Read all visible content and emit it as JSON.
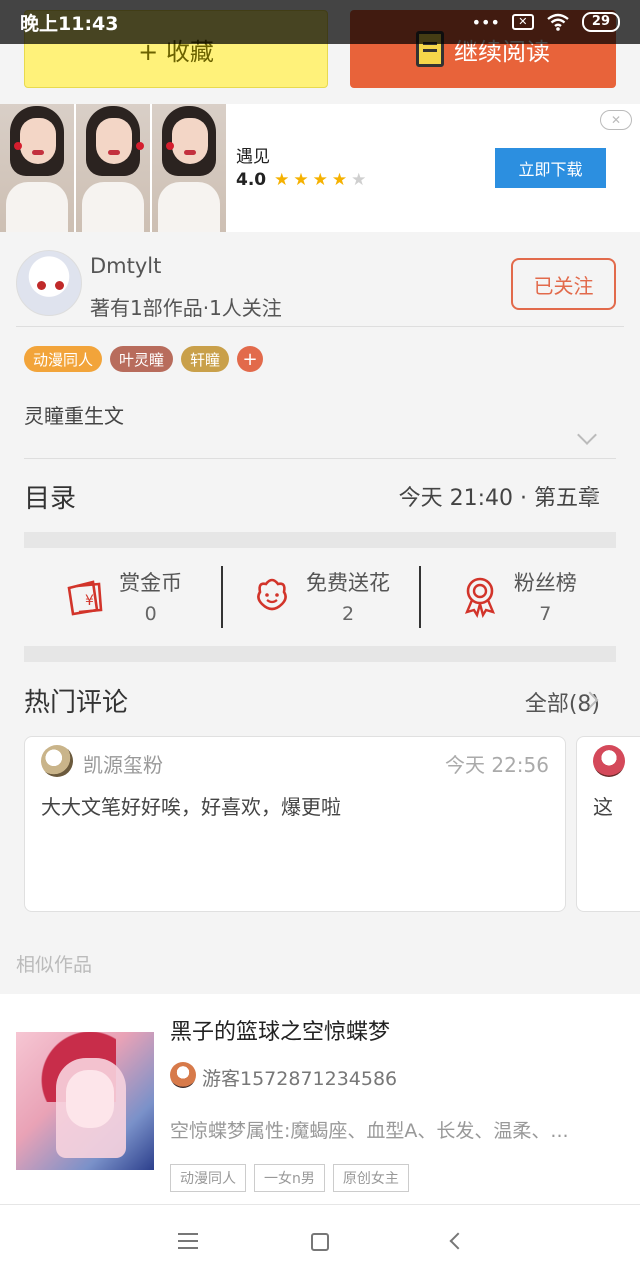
{
  "status_bar": {
    "time": "晚上11:43",
    "battery": "29"
  },
  "top_actions": {
    "collect_label": "+ 收藏",
    "continue_label": "继续阅读"
  },
  "ad": {
    "app_name": "遇见",
    "rating": "4.0",
    "rating_stars": 4,
    "download_label": "立即下载",
    "close_symbol": "✕"
  },
  "author": {
    "name": "Dmtylt",
    "meta": "著有1部作品·1人关注",
    "follow_label": "已关注"
  },
  "tags": [
    {
      "label": "动漫同人",
      "color": "#f2a43a"
    },
    {
      "label": "叶灵瞳",
      "color": "#b86c5c"
    },
    {
      "label": "轩瞳",
      "color": "#c9a04a"
    }
  ],
  "tag_add": "+",
  "intro": "灵瞳重生文",
  "catalog": {
    "title": "目录",
    "latest": "今天 21:40 · 第五章"
  },
  "stats": [
    {
      "icon": "red-envelope-icon",
      "label": "赏金币",
      "value": "0"
    },
    {
      "icon": "flower-icon",
      "label": "免费送花",
      "value": "2"
    },
    {
      "icon": "medal-icon",
      "label": "粉丝榜",
      "value": "7"
    }
  ],
  "comments": {
    "title": "热门评论",
    "all_label": "全部(8)",
    "items": [
      {
        "user": "凯源玺粉",
        "time": "今天 22:56",
        "text": "大大文笔好好唉，好喜欢，爆更啦"
      },
      {
        "user": "",
        "time": "",
        "text": "这"
      }
    ]
  },
  "similar": {
    "label": "相似作品",
    "work": {
      "title": "黑子的篮球之空惊蝶梦",
      "author": "游客1572871234586",
      "desc": "空惊蝶梦属性:魔蝎座、血型A、长发、温柔、...",
      "tags": [
        "动漫同人",
        "一女n男",
        "原创女主"
      ]
    }
  },
  "colors": {
    "accent": "#e8633a",
    "collect": "#fff27a",
    "ad_button": "#2c8fe0",
    "stat_icon": "#d2342a"
  }
}
